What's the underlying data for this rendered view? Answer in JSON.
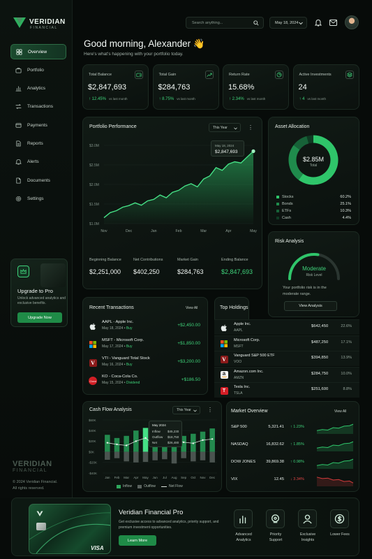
{
  "brand": {
    "name": "VERIDIAN",
    "sub": "FINANCIAL"
  },
  "header": {
    "greeting": "Good morning, Alexander 👋",
    "subtitle": "Here's what's happening with your portfolio today.",
    "search_placeholder": "Search anything...",
    "date": "May 18, 2024"
  },
  "nav": [
    {
      "label": "Overview",
      "icon": "grid-icon"
    },
    {
      "label": "Portfolio",
      "icon": "briefcase-icon"
    },
    {
      "label": "Analytics",
      "icon": "bar-chart-icon"
    },
    {
      "label": "Transactions",
      "icon": "transfer-icon"
    },
    {
      "label": "Payments",
      "icon": "card-icon"
    },
    {
      "label": "Reports",
      "icon": "document-icon"
    },
    {
      "label": "Alerts",
      "icon": "bell-icon"
    },
    {
      "label": "Documents",
      "icon": "file-icon"
    },
    {
      "label": "Settings",
      "icon": "gear-icon"
    }
  ],
  "upgrade": {
    "title": "Upgrade to Pro",
    "text": "Unlock advanced analytics and exclusive benefits.",
    "button": "Upgrade Now"
  },
  "footer": {
    "brand": "VERIDIAN",
    "sub": "FINANCIAL",
    "copyright": "© 2024 Veridian Financial.",
    "rights": "All rights reserved."
  },
  "stats": [
    {
      "label": "Total Balance",
      "value": "$2,847,693",
      "change": "↑ 12.45%",
      "sub": "vs last month"
    },
    {
      "label": "Total Gain",
      "value": "$284,763",
      "change": "↑ 8.75%",
      "sub": "vs last month"
    },
    {
      "label": "Return Rate",
      "value": "15.68%",
      "change": "↑ 2.34%",
      "sub": "vs last month"
    },
    {
      "label": "Active Investments",
      "value": "24",
      "change": "↑ 4",
      "sub": "vs last month"
    }
  ],
  "performance": {
    "title": "Portfolio Performance",
    "period": "This Year",
    "tooltip_date": "May 18, 2024",
    "tooltip_value": "$2,847,693",
    "summary": [
      {
        "label": "Beginning Balance",
        "value": "$2,251,000"
      },
      {
        "label": "Net Contributions",
        "value": "$402,250"
      },
      {
        "label": "Market Gain",
        "value": "$284,763"
      },
      {
        "label": "Ending Balance",
        "value": "$2,847,693"
      }
    ]
  },
  "allocation": {
    "title": "Asset Allocation",
    "center_value": "$2.85M",
    "center_label": "Total",
    "items": [
      {
        "label": "Stocks",
        "pct": "60.2%",
        "value": 60.2,
        "color": "#2fc56a"
      },
      {
        "label": "Bonds",
        "pct": "25.1%",
        "value": 25.1,
        "color": "#1f8b4c"
      },
      {
        "label": "ETFs",
        "pct": "10.3%",
        "value": 10.3,
        "color": "#176238"
      },
      {
        "label": "Cash",
        "pct": "4.4%",
        "value": 4.4,
        "color": "#0f3a23"
      }
    ]
  },
  "risk": {
    "title": "Risk Analysis",
    "level": "Moderate",
    "level_label": "Risk Level",
    "text": "Your portfolio risk is in the moderate range.",
    "button": "View Analysis",
    "gauge_fraction": 0.55
  },
  "transactions": {
    "title": "Recent Transactions",
    "view_all": "View All",
    "items": [
      {
        "name": "AAPL - Apple Inc.",
        "date": "May 18, 2024",
        "type": "Buy",
        "amount": "+$2,450.00",
        "logo": "apple-logo"
      },
      {
        "name": "MSFT - Microsoft Corp.",
        "date": "May 17, 2024",
        "type": "Buy",
        "amount": "+$1,850.00",
        "logo": "microsoft-logo"
      },
      {
        "name": "VTI - Vanguard Total Stock",
        "date": "May 16, 2024",
        "type": "Buy",
        "amount": "+$3,200.00",
        "logo": "vanguard-logo"
      },
      {
        "name": "KO - Coca-Cola Co.",
        "date": "May 15, 2024",
        "type": "Dividend",
        "amount": "+$186.50",
        "logo": "cocacola-logo"
      }
    ]
  },
  "holdings": {
    "title": "Top Holdings",
    "items": [
      {
        "name": "Apple Inc.",
        "ticker": "AAPL",
        "value": "$642,450",
        "pct": "22.6%",
        "logo": "apple-logo"
      },
      {
        "name": "Microsoft Corp.",
        "ticker": "MSFT",
        "value": "$487,250",
        "pct": "17.1%",
        "logo": "microsoft-logo"
      },
      {
        "name": "Vanguard S&P 500 ETF",
        "ticker": "VOO",
        "value": "$394,850",
        "pct": "13.9%",
        "logo": "vanguard-logo"
      },
      {
        "name": "Amazon.com Inc.",
        "ticker": "AMZN",
        "value": "$284,750",
        "pct": "10.0%",
        "logo": "amazon-logo"
      },
      {
        "name": "Tesla Inc.",
        "ticker": "TSLA",
        "value": "$251,600",
        "pct": "8.8%",
        "logo": "tesla-logo"
      }
    ]
  },
  "cashflow": {
    "title": "Cash Flow Analysis",
    "period": "This Year",
    "tooltip": {
      "month": "May 2024",
      "inflow_label": "Inflow",
      "inflow": "$45,230",
      "outflow_label": "Outflow",
      "outflow": "$18,750",
      "net_label": "Net",
      "net": "$26,480"
    },
    "legend": [
      "Inflow",
      "Outflow",
      "Net Flow"
    ]
  },
  "market": {
    "title": "Market Overview",
    "view_all": "View All",
    "items": [
      {
        "name": "S&P 500",
        "value": "5,321.41",
        "change": "↑ 1.23%",
        "up": true
      },
      {
        "name": "NASDAQ",
        "value": "16,832.62",
        "change": "↑ 1.85%",
        "up": true
      },
      {
        "name": "DOW JONES",
        "value": "39,869.38",
        "change": "↑ 0.98%",
        "up": true
      },
      {
        "name": "VIX",
        "value": "12.45",
        "change": "↓ 3.34%",
        "up": false
      }
    ]
  },
  "pro": {
    "title": "Veridian Financial Pro",
    "text": "Get exclusive access to advanced analytics, priority support, and premium investment opportunities.",
    "button": "Learn More",
    "card_brand": "VISA",
    "features": [
      {
        "label1": "Advanced",
        "label2": "Analytics",
        "icon": "analytics-icon"
      },
      {
        "label1": "Priority",
        "label2": "Support",
        "icon": "support-icon"
      },
      {
        "label1": "Exclusive",
        "label2": "Insights",
        "icon": "insights-icon"
      },
      {
        "label1": "Lower Fees",
        "label2": "",
        "icon": "fees-icon"
      }
    ]
  },
  "chart_data": [
    {
      "type": "area",
      "title": "Portfolio Performance",
      "categories": [
        "Nov",
        "Dec",
        "Jan",
        "Feb",
        "Mar",
        "Apr",
        "May"
      ],
      "y_ticks": [
        "$1.0M",
        "$1.5M",
        "$2.0M",
        "$2.5M",
        "$3.0M"
      ],
      "ylim": [
        1.0,
        3.0
      ],
      "x": [
        0,
        0.25,
        0.5,
        0.75,
        1,
        1.25,
        1.5,
        1.75,
        2,
        2.25,
        2.5,
        2.75,
        3,
        3.25,
        3.5,
        3.75,
        4,
        4.25,
        4.5,
        4.75,
        5,
        5.25,
        5.5,
        5.75,
        6
      ],
      "values": [
        1.15,
        1.28,
        1.33,
        1.42,
        1.46,
        1.53,
        1.47,
        1.58,
        1.62,
        1.73,
        1.66,
        1.8,
        1.85,
        1.96,
        2.02,
        1.94,
        2.14,
        2.22,
        2.43,
        2.36,
        2.52,
        2.58,
        2.55,
        2.7,
        2.85
      ]
    },
    {
      "type": "bar",
      "title": "Cash Flow Analysis",
      "categories": [
        "Jan",
        "Feb",
        "Mar",
        "Apr",
        "May",
        "Jun",
        "Jul",
        "Aug",
        "Sep",
        "Oct",
        "Nov",
        "Dec"
      ],
      "y_ticks": [
        "$60K",
        "$40K",
        "$20K",
        "$0K",
        "-$20K",
        "-$40K"
      ],
      "ylim": [
        -40,
        60
      ],
      "series": [
        {
          "name": "Inflow",
          "values": [
            32,
            26,
            30,
            40,
            45,
            28,
            36,
            42,
            30,
            34,
            38,
            44
          ]
        },
        {
          "name": "Outflow",
          "values": [
            -15,
            -12,
            -18,
            -20,
            -19,
            -16,
            -14,
            -22,
            -12,
            -18,
            -16,
            -20
          ]
        },
        {
          "name": "Net Flow",
          "values": [
            17,
            14,
            12,
            20,
            26,
            12,
            22,
            20,
            18,
            16,
            22,
            24
          ]
        }
      ]
    }
  ]
}
